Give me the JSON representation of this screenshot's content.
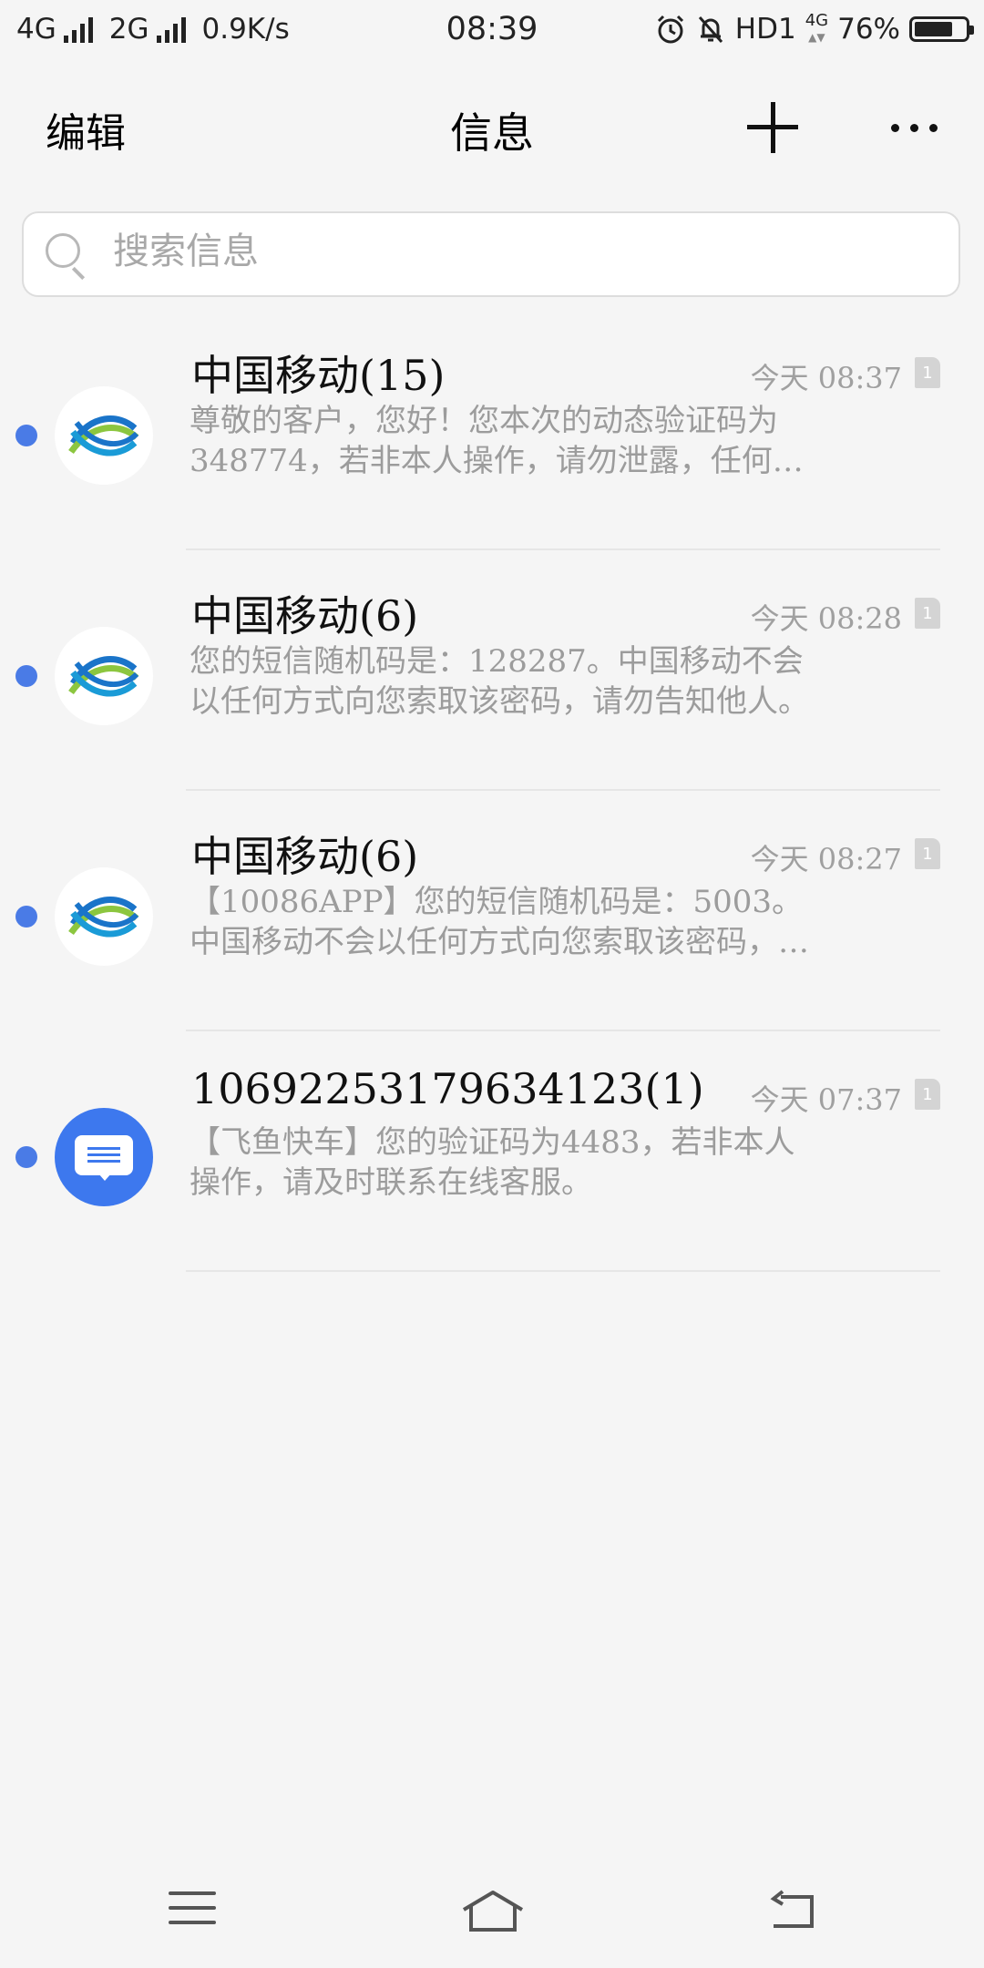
{
  "status_bar": {
    "net1": "4G",
    "net2": "2G",
    "speed": "0.9K/s",
    "time": "08:39",
    "hd": "HD1",
    "lte": "4G",
    "battery_text": "76%",
    "battery_level": 0.76
  },
  "header": {
    "edit_label": "编辑",
    "title": "信息"
  },
  "search": {
    "placeholder": "搜索信息"
  },
  "conversations": [
    {
      "sender": "中国移动(15)",
      "time": "今天 08:37",
      "sim": "1",
      "avatar": "china-mobile-logo",
      "preview_line1": "尊敬的客户，您好！您本次的动态验证码为",
      "preview_line2": "348774，若非本人操作，请勿泄露，任何…"
    },
    {
      "sender": "中国移动(6)",
      "time": "今天 08:28",
      "sim": "1",
      "avatar": "china-mobile-logo",
      "preview_line1": "您的短信随机码是：128287。中国移动不会",
      "preview_line2": "以任何方式向您索取该密码，请勿告知他人。"
    },
    {
      "sender": "中国移动(6)",
      "time": "今天 08:27",
      "sim": "1",
      "avatar": "china-mobile-logo",
      "preview_line1": "【10086APP】您的短信随机码是：5003。",
      "preview_line2": "中国移动不会以任何方式向您索取该密码，…"
    },
    {
      "sender": "1069225317963412​3(1)",
      "time": "今天 07:37",
      "sim": "1",
      "avatar": "message-bubble-icon",
      "preview_line1": "【飞鱼快车】您的验证码为4483，若非本人",
      "preview_line2": "操作，请及时联系在线客服。"
    }
  ],
  "colors": {
    "unread_dot": "#4a7be6",
    "sms_avatar": "#3d78ee",
    "background": "#f5f5f5"
  }
}
